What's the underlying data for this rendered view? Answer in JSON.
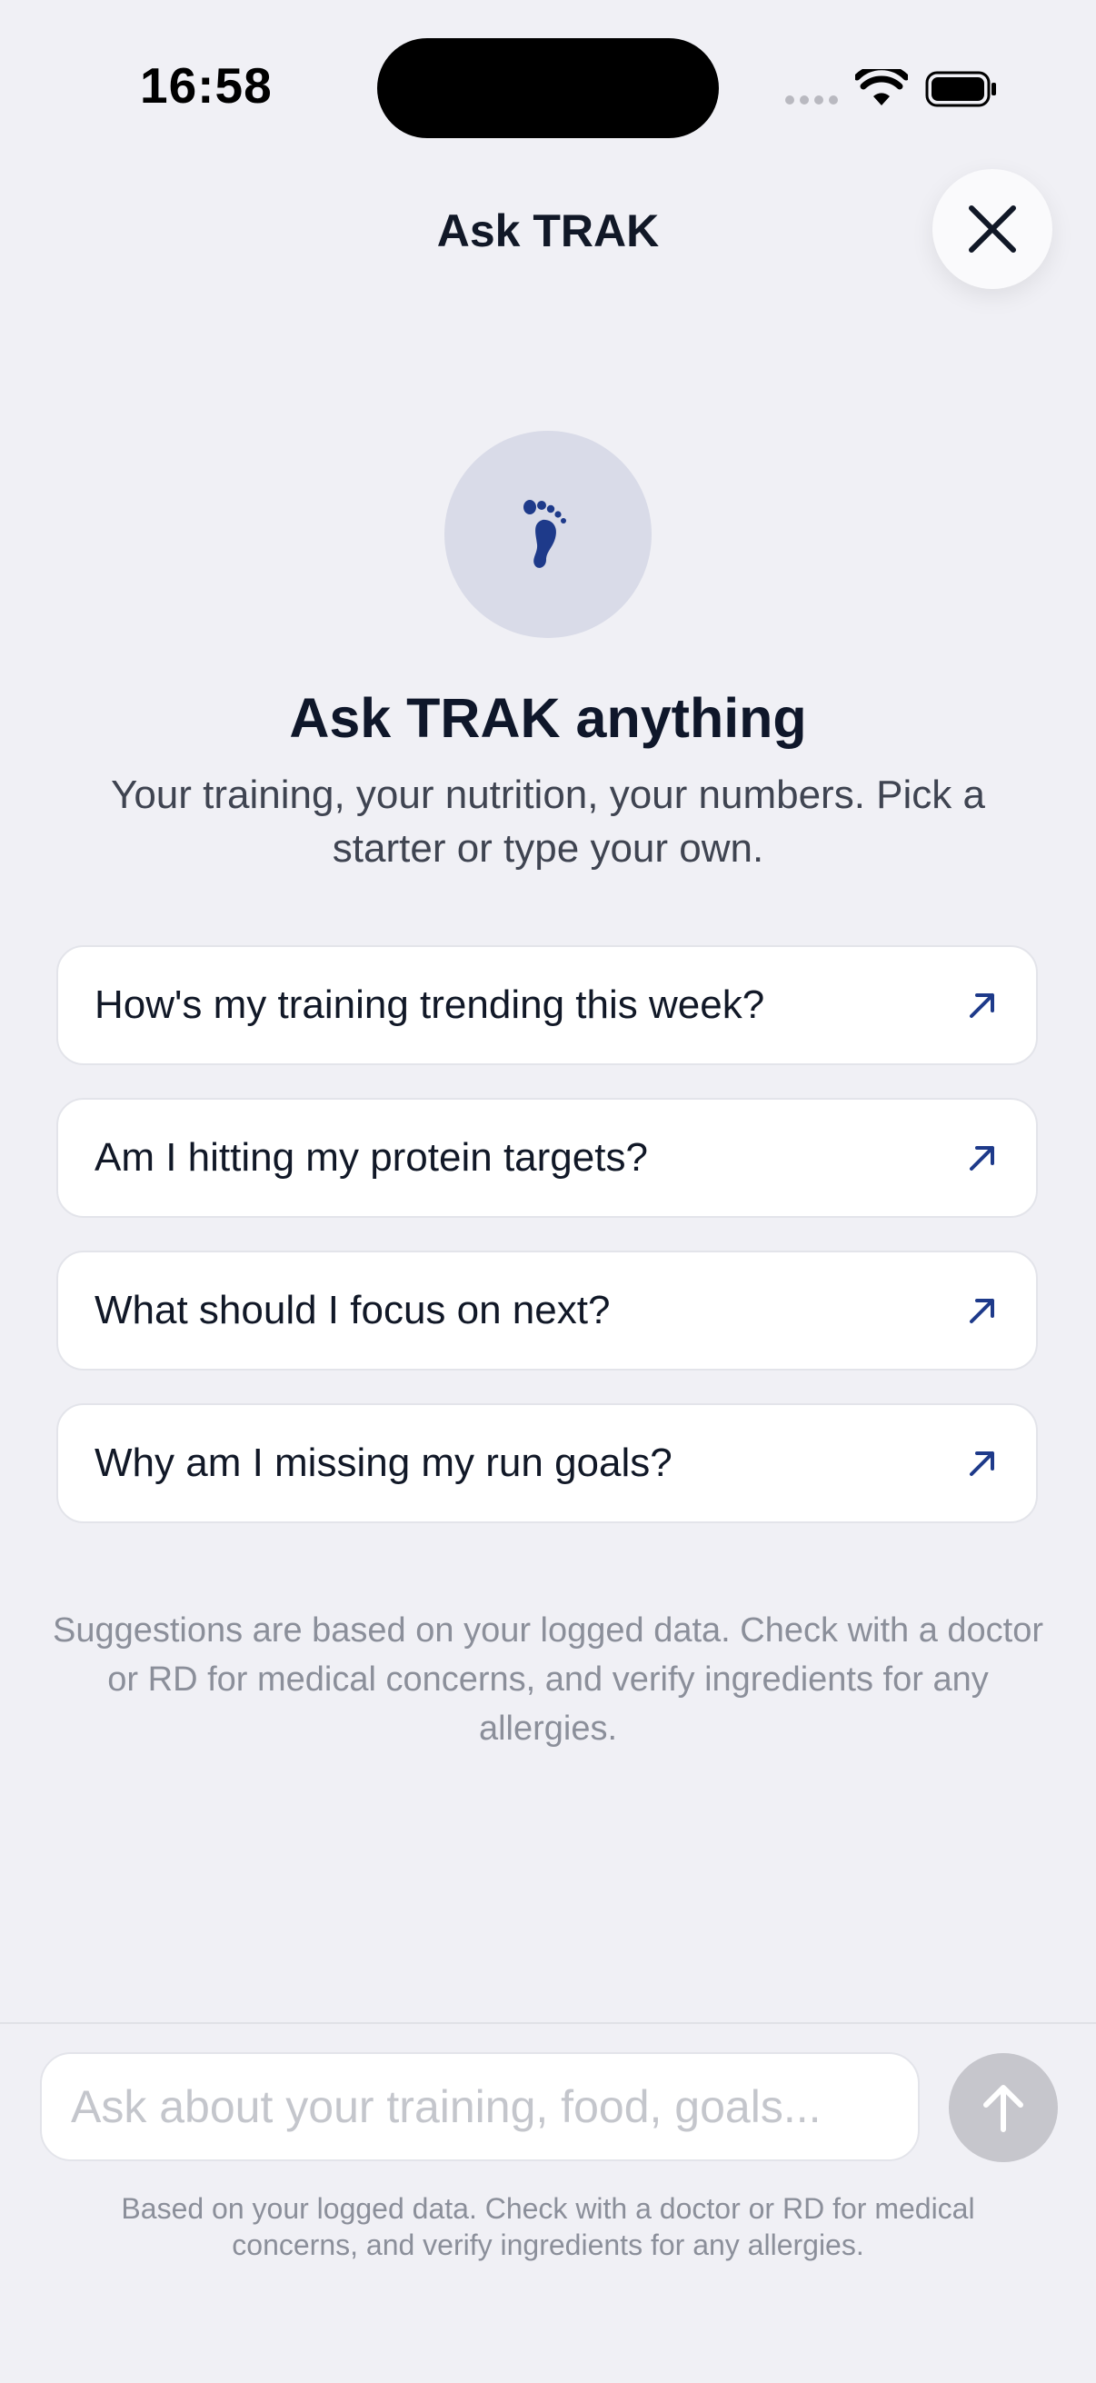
{
  "status_bar": {
    "time": "16:58"
  },
  "header": {
    "title": "Ask TRAK",
    "close_icon": "close-icon"
  },
  "hero": {
    "icon": "footprint-icon",
    "title": "Ask TRAK anything",
    "subtitle": "Your training, your nutrition, your numbers. Pick a starter or type your own."
  },
  "suggestions": [
    {
      "label": "How's my training trending this week?",
      "icon": "arrow-up-right-icon"
    },
    {
      "label": "Am I hitting my protein targets?",
      "icon": "arrow-up-right-icon"
    },
    {
      "label": "What should I focus on next?",
      "icon": "arrow-up-right-icon"
    },
    {
      "label": "Why am I missing my run goals?",
      "icon": "arrow-up-right-icon"
    }
  ],
  "disclaimer": "Suggestions are based on your logged data. Check with a doctor or RD for medical concerns, and verify ingredients for any allergies.",
  "composer": {
    "placeholder": "Ask about your training, food, goals...",
    "value": "",
    "send_icon": "arrow-up-icon"
  },
  "footer_note": "Based on your logged data. Check with a doctor or RD for medical concerns, and verify ingredients for any allergies.",
  "colors": {
    "accent": "#1e3a8a",
    "background": "#f0f0f5",
    "send_disabled": "#c6c6cc"
  }
}
